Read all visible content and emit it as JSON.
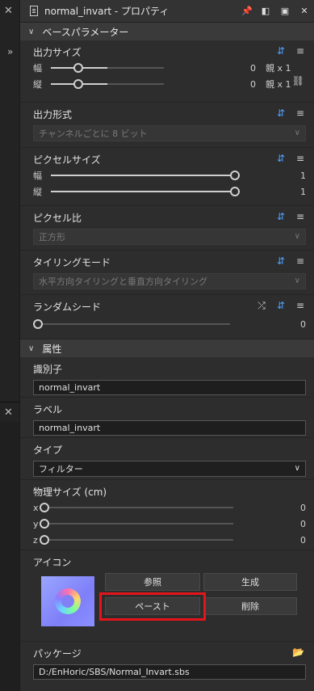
{
  "window": {
    "title": "normal_invart - プロパティ"
  },
  "sections": {
    "base_params": "ベースパラメーター",
    "attributes": "属性"
  },
  "output_size": {
    "label": "出力サイズ",
    "width_label": "幅",
    "height_label": "縦",
    "width_value": "0",
    "height_value": "0",
    "width_ratio": "親 x 1",
    "height_ratio": "親 x 1"
  },
  "output_format": {
    "label": "出力形式",
    "value": "チャンネルごとに 8 ビット"
  },
  "pixel_size": {
    "label": "ピクセルサイズ",
    "width_label": "幅",
    "height_label": "縦",
    "width_value": "1",
    "height_value": "1"
  },
  "pixel_ratio": {
    "label": "ピクセル比",
    "value": "正方形"
  },
  "tiling_mode": {
    "label": "タイリングモード",
    "value": "水平方向タイリングと垂直方向タイリング"
  },
  "random_seed": {
    "label": "ランダムシード",
    "value": "0"
  },
  "identifier": {
    "label": "識別子",
    "value": "normal_invart"
  },
  "label_field": {
    "label": "ラベル",
    "value": "normal_invart"
  },
  "type_field": {
    "label": "タイプ",
    "value": "フィルター"
  },
  "physical_size": {
    "label": "物理サイズ (cm)",
    "x_label": "x",
    "y_label": "y",
    "z_label": "z",
    "x_value": "0",
    "y_value": "0",
    "z_value": "0"
  },
  "icon_section": {
    "label": "アイコン",
    "browse": "参照",
    "generate": "生成",
    "paste": "ペースト",
    "delete": "削除"
  },
  "package": {
    "label": "パッケージ",
    "path": "D:/EnHoric/SBS/Normal_Invart.sbs"
  },
  "colors": {
    "accent_highlight": "#e3151a",
    "icon_blue": "#4ea0ff"
  }
}
